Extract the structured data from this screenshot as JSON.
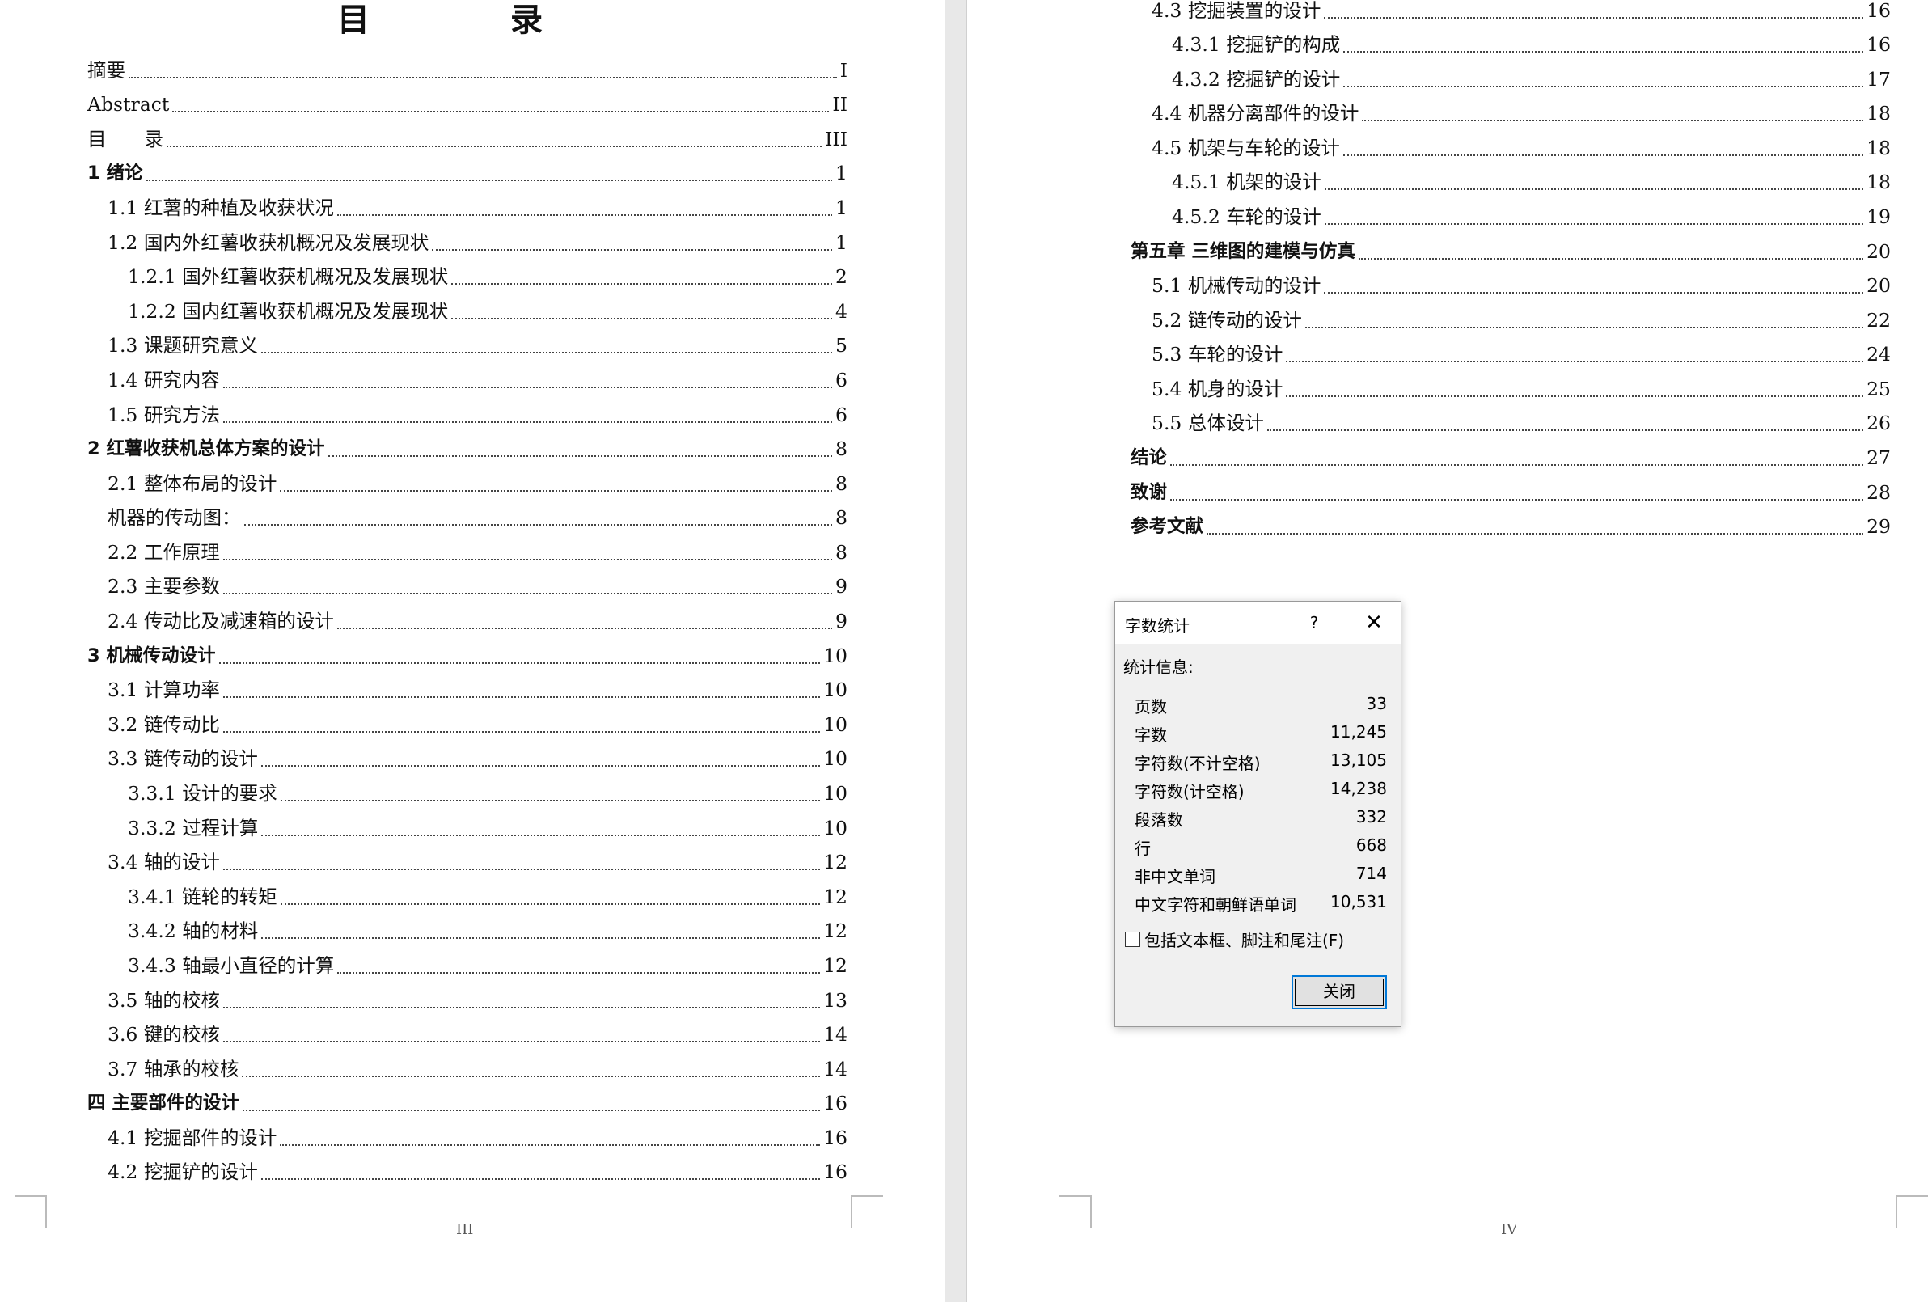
{
  "left_page": {
    "heading": "目 录",
    "page_number": "III",
    "entries": [
      {
        "label": "摘要",
        "page": "I"
      },
      {
        "label": "Abstract",
        "page": "II"
      },
      {
        "label": "目　　录",
        "page": "III"
      },
      {
        "label": "1 绪论",
        "page": "1"
      },
      {
        "label": "1.1 红薯的种植及收获状况",
        "page": "1"
      },
      {
        "label": "1.2 国内外红薯收获机概况及发展现状",
        "page": "1"
      },
      {
        "label": "1.2.1 国外红薯收获机概况及发展现状",
        "page": "2"
      },
      {
        "label": "1.2.2 国内红薯收获机概况及发展现状",
        "page": "4"
      },
      {
        "label": "1.3 课题研究意义",
        "page": "5"
      },
      {
        "label": "1.4 研究内容",
        "page": "6"
      },
      {
        "label": "1.5  研究方法",
        "page": "6"
      },
      {
        "label": "2 红薯收获机总体方案的设计",
        "page": "8"
      },
      {
        "label": "2.1 整体布局的设计",
        "page": "8"
      },
      {
        "label": "机器的传动图：",
        "page": "8"
      },
      {
        "label": "2.2 工作原理",
        "page": "8"
      },
      {
        "label": "2.3 主要参数",
        "page": "9"
      },
      {
        "label": "2.4 传动比及减速箱的设计",
        "page": "9"
      },
      {
        "label": "3   机械传动设计",
        "page": "10"
      },
      {
        "label": "3.1 计算功率",
        "page": "10"
      },
      {
        "label": "3.2 链传动比",
        "page": "10"
      },
      {
        "label": "3.3 链传动的设计",
        "page": "10"
      },
      {
        "label": "3.3.1 设计的要求",
        "page": "10"
      },
      {
        "label": "3.3.2 过程计算",
        "page": "10"
      },
      {
        "label": "3.4 轴的设计",
        "page": "12"
      },
      {
        "label": "3.4.1 链轮的转矩",
        "page": "12"
      },
      {
        "label": "3.4.2 轴的材料",
        "page": "12"
      },
      {
        "label": "3.4.3 轴最小直径的计算",
        "page": "12"
      },
      {
        "label": "3.5 轴的校核",
        "page": "13"
      },
      {
        "label": "3.6  键的校核",
        "page": "14"
      },
      {
        "label": "3.7  轴承的校核",
        "page": "14"
      },
      {
        "label": "四 主要部件的设计",
        "page": "16"
      },
      {
        "label": "4.1  挖掘部件的设计",
        "page": "16"
      },
      {
        "label": "4.2  挖掘铲的设计",
        "page": "16"
      }
    ]
  },
  "right_page": {
    "page_number": "IV",
    "entries": [
      {
        "label": "4.3 挖掘装置的设计",
        "page": "16"
      },
      {
        "label": "4.3.1 挖掘铲的构成",
        "page": "16"
      },
      {
        "label": "4.3.2 挖掘铲的设计",
        "page": "17"
      },
      {
        "label": "4.4  机器分离部件的设计",
        "page": "18"
      },
      {
        "label": "4.5  机架与车轮的设计",
        "page": "18"
      },
      {
        "label": "4.5.1  机架的设计",
        "page": "18"
      },
      {
        "label": "4.5.2  车轮的设计",
        "page": "19"
      },
      {
        "label": "第五章  三维图的建模与仿真",
        "page": "20"
      },
      {
        "label": "5.1 机械传动的设计",
        "page": "20"
      },
      {
        "label": "5.2 链传动的设计",
        "page": "22"
      },
      {
        "label": "5.3 车轮的设计",
        "page": "24"
      },
      {
        "label": "5.4 机身的设计",
        "page": "25"
      },
      {
        "label": "5.5 总体设计",
        "page": "26"
      },
      {
        "label": "结论",
        "page": "27"
      },
      {
        "label": "致谢",
        "page": "28"
      },
      {
        "label": "参考文献",
        "page": "29"
      }
    ]
  },
  "dialog": {
    "title": "字数统计",
    "help": "?",
    "close_glyph": "✕",
    "section": "统计信息:",
    "stats": [
      {
        "label": "页数",
        "value": "33"
      },
      {
        "label": "字数",
        "value": "11,245"
      },
      {
        "label": "字符数(不计空格)",
        "value": "13,105"
      },
      {
        "label": "字符数(计空格)",
        "value": "14,238"
      },
      {
        "label": "段落数",
        "value": "332"
      },
      {
        "label": "行",
        "value": "668"
      },
      {
        "label": "非中文单词",
        "value": "714"
      },
      {
        "label": "中文字符和朝鲜语单词",
        "value": "10,531"
      }
    ],
    "checkbox_label": "包括文本框、脚注和尾注(F)",
    "checkbox_checked": false,
    "close_button": "关闭",
    "accent_color": "#0078d7"
  }
}
